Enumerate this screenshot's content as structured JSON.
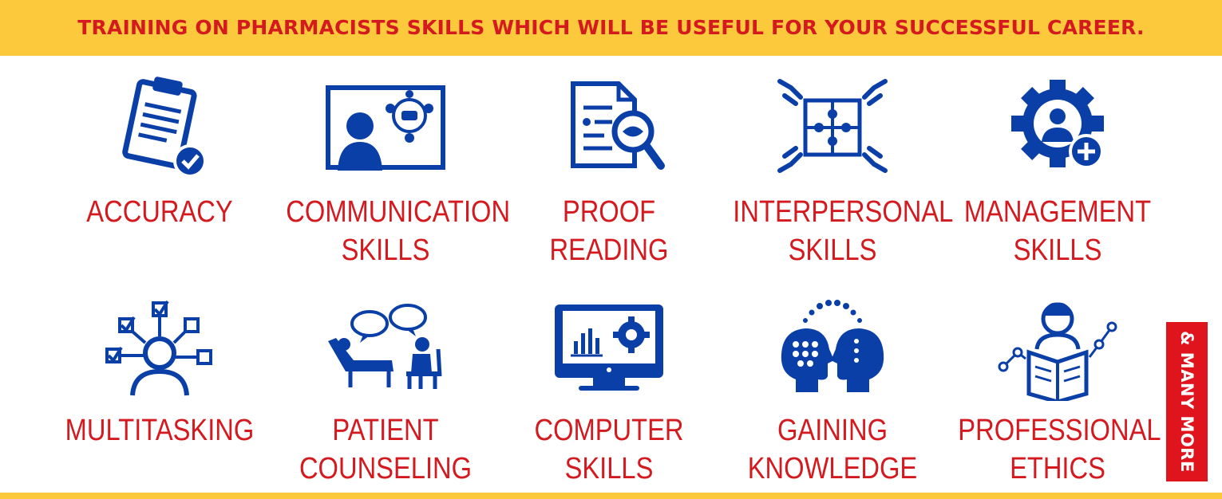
{
  "banner": {
    "text": "TRAINING ON PHARMACISTS SKILLS WHICH WILL BE USEFUL FOR YOUR SUCCESSFUL CAREER."
  },
  "colors": {
    "banner_background": "#fbc93b",
    "title_red": "#d4191f",
    "icon_blue": "#0b3fa8",
    "badge_red": "#e0141c"
  },
  "skills": [
    {
      "icon": "clipboard-check-icon",
      "line1": "ACCURACY",
      "line2": ""
    },
    {
      "icon": "presentation-board-icon",
      "line1": "COMMUNICATION",
      "line2": "SKILLS"
    },
    {
      "icon": "document-magnifier-icon",
      "line1": "PROOF",
      "line2": "READING"
    },
    {
      "icon": "puzzle-hands-icon",
      "line1": "INTERPERSONAL",
      "line2": "SKILLS"
    },
    {
      "icon": "gear-person-plus-icon",
      "line1": "MANAGEMENT",
      "line2": "SKILLS"
    },
    {
      "icon": "person-checkboxes-icon",
      "line1": "MULTITASKING",
      "line2": ""
    },
    {
      "icon": "counseling-couch-icon",
      "line1": "PATIENT",
      "line2": "COUNSELING"
    },
    {
      "icon": "monitor-chart-gear-icon",
      "line1": "COMPUTER",
      "line2": "SKILLS"
    },
    {
      "icon": "two-heads-knowledge-icon",
      "line1": "GAINING",
      "line2": "KNOWLEDGE"
    },
    {
      "icon": "reader-book-graph-icon",
      "line1": "PROFESSIONAL",
      "line2": "ETHICS"
    }
  ],
  "badge": {
    "text": "& MANY MORE"
  }
}
